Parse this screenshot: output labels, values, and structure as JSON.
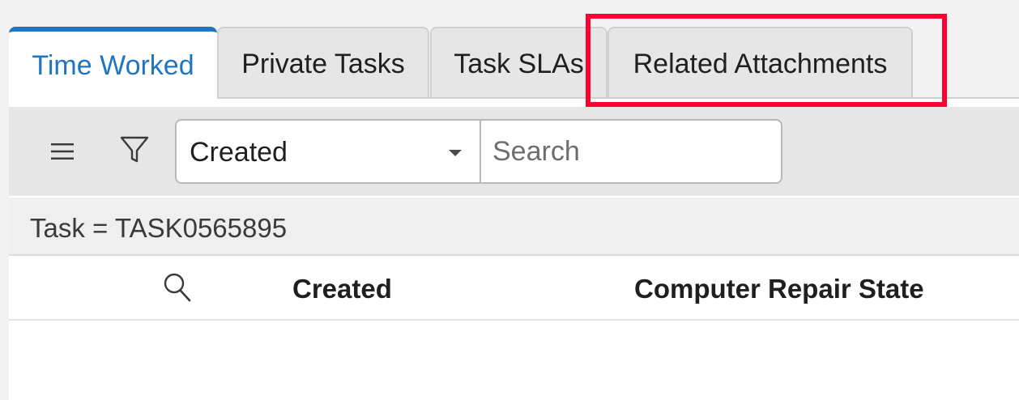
{
  "tabs": [
    {
      "label": "Time Worked",
      "active": true
    },
    {
      "label": "Private Tasks",
      "active": false
    },
    {
      "label": "Task SLAs",
      "active": false
    },
    {
      "label": "Related Attachments",
      "active": false
    }
  ],
  "toolbar": {
    "menu_icon": "hamburger-menu-icon",
    "filter_icon": "funnel-filter-icon",
    "field_select": {
      "selected": "Created"
    },
    "search": {
      "value": "",
      "placeholder": "Search"
    }
  },
  "breadcrumb": {
    "text": "Task = TASK0565895"
  },
  "table": {
    "columns": [
      "Created",
      "Computer Repair State"
    ]
  },
  "colors": {
    "accent": "#1f76c0",
    "highlight": "#ff0033"
  }
}
